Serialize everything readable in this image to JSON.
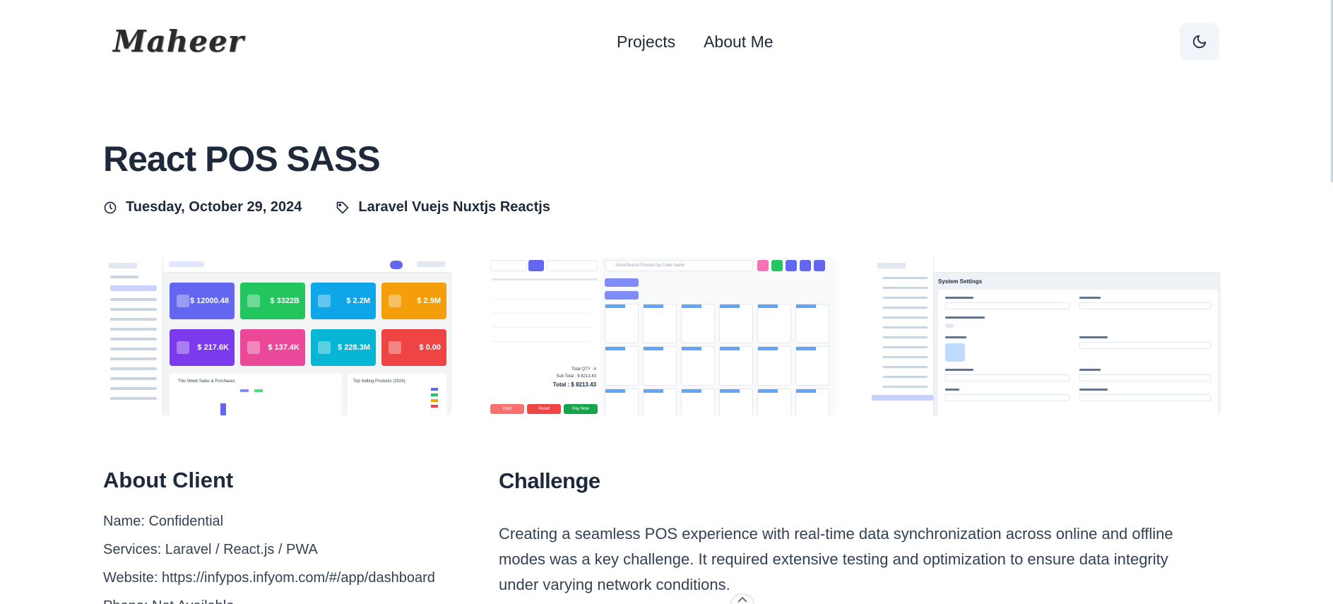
{
  "header": {
    "logo_text": "Maheer",
    "nav": [
      {
        "label": "Projects"
      },
      {
        "label": "About Me"
      }
    ],
    "theme_toggle_icon": "moon-icon"
  },
  "project": {
    "title": "React POS SASS",
    "date": "Tuesday, October 29, 2024",
    "tags": "Laravel Vuejs Nuxtjs Reactjs",
    "date_icon": "clock-icon",
    "tags_icon": "tag-icon"
  },
  "screenshots": {
    "dashboard": {
      "cards": [
        {
          "value": "$ 12000.48",
          "color": "#6366f1"
        },
        {
          "value": "$ 3322B",
          "color": "#22c55e"
        },
        {
          "value": "$ 2.2M",
          "color": "#0ea5e9"
        },
        {
          "value": "$ 2.9M",
          "color": "#f59e0b"
        },
        {
          "value": "$ 217.6K",
          "color": "#7c3aed"
        },
        {
          "value": "$ 137.4K",
          "color": "#ec4899"
        },
        {
          "value": "$ 228.3M",
          "color": "#06b6d4"
        },
        {
          "value": "$ 0.00",
          "color": "#ef4444"
        }
      ],
      "panel_left_title": "This Week Sales & Purchases",
      "panel_right_title": "Top Selling Products (2024)"
    },
    "pos": {
      "search_placeholder": "Scan/Search Product by Code Name",
      "total_qty": "Total QTY : 4",
      "sub_total": "Sub Total : $ 8213.43",
      "total": "Total : $ 8213.43",
      "buttons": [
        {
          "label": "Hold",
          "color": "#f87171"
        },
        {
          "label": "Reset",
          "color": "#ef4444"
        },
        {
          "label": "Pay Now",
          "color": "#16a34a"
        }
      ]
    },
    "settings": {
      "page_title": "System Settings"
    }
  },
  "about_client": {
    "title": "About Client",
    "items": [
      "Name: Confidential",
      "Services: Laravel / React.js / PWA",
      "Website: https://infypos.infyom.com/#/app/dashboard",
      "Phone: Not Available"
    ]
  },
  "challenge": {
    "title": "Challenge",
    "text": "Creating a seamless POS experience with real-time data synchronization across online and offline modes was a key challenge. It required extensive testing and optimization to ensure data integrity under varying network conditions."
  }
}
